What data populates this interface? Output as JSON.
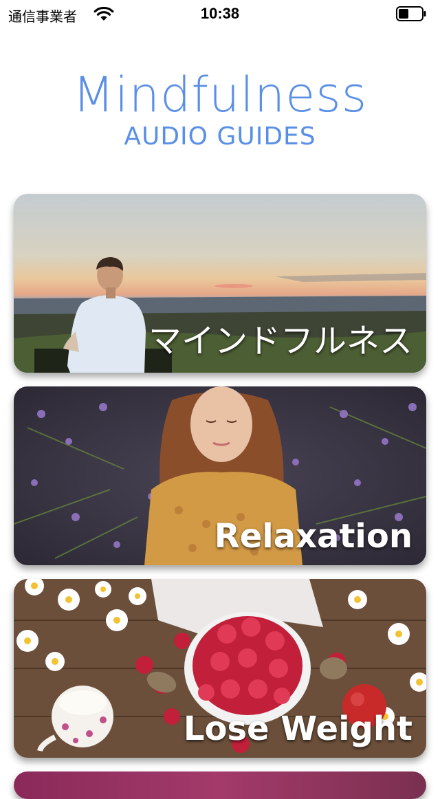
{
  "status_bar": {
    "carrier": "通信事業者",
    "time": "10:38"
  },
  "header": {
    "title": "Mindfulness",
    "subtitle": "AUDIO GUIDES"
  },
  "cards": [
    {
      "label": "マインドフルネス",
      "image": "meditating-man-sunset"
    },
    {
      "label": "Relaxation",
      "image": "girl-in-lavender"
    },
    {
      "label": "Lose Weight",
      "image": "raspberries-and-daisies"
    }
  ],
  "colors": {
    "accent": "#5a8fe6"
  }
}
